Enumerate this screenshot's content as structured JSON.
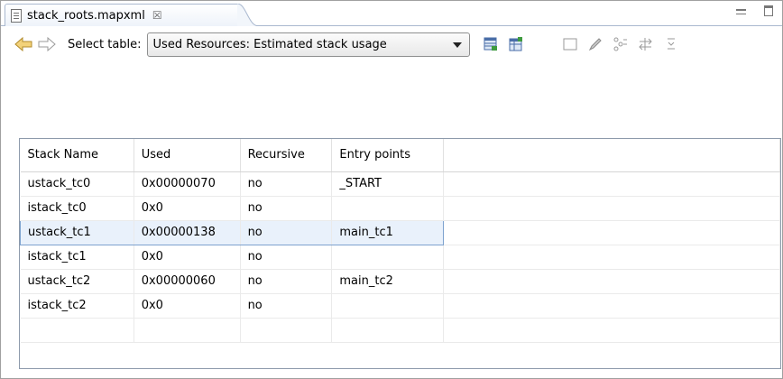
{
  "tab": {
    "title": "stack_roots.mapxml",
    "close_glyph": "☒"
  },
  "toolbar": {
    "select_label": "Select table:",
    "select_value": "Used Resources: Estimated stack usage",
    "icons": [
      "back-arrow-icon",
      "forward-arrow-icon",
      "table-export-icon",
      "table-import-icon",
      "blank-panel-icon",
      "pen-icon",
      "tree-view-icon",
      "sort-icon",
      "filter-icon"
    ]
  },
  "table": {
    "columns": [
      "Stack Name",
      "Used",
      "Recursive",
      "Entry points"
    ],
    "rows": [
      [
        "ustack_tc0",
        "0x00000070",
        "no",
        "_START"
      ],
      [
        "istack_tc0",
        "0x0",
        "no",
        ""
      ],
      [
        "ustack_tc1",
        "0x00000138",
        "no",
        "main_tc1"
      ],
      [
        "istack_tc1",
        "0x0",
        "no",
        ""
      ],
      [
        "ustack_tc2",
        "0x00000060",
        "no",
        "main_tc2"
      ],
      [
        "istack_tc2",
        "0x0",
        "no",
        ""
      ]
    ],
    "selected_row": 2
  },
  "colors": {
    "selection_bg": "#e9f1fb",
    "selection_border": "#7da2ce",
    "arrow_fill": "#f3d27a"
  }
}
